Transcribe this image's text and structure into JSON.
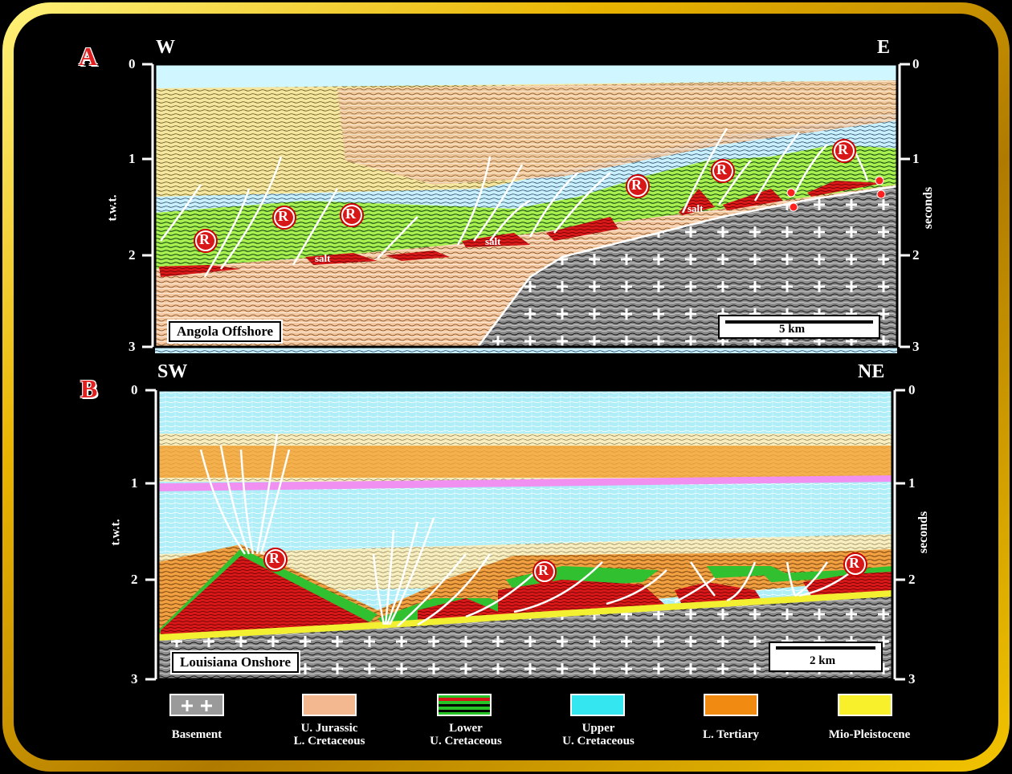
{
  "panel_a": {
    "letter": "A",
    "left_dir": "W",
    "right_dir": "E",
    "left_axis_label": "t.w.t.",
    "right_axis_label": "seconds",
    "ticks": [
      "0",
      "1",
      "2",
      "3"
    ],
    "location": "Angola Offshore",
    "scale": "5 km",
    "salt_label": "salt",
    "reservoir_symbol": "R"
  },
  "panel_b": {
    "letter": "B",
    "left_dir": "SW",
    "right_dir": "NE",
    "left_axis_label": "t.w.t.",
    "right_axis_label": "seconds",
    "ticks": [
      "0",
      "1",
      "2",
      "3"
    ],
    "location": "Louisiana Onshore",
    "scale": "2 km",
    "reservoir_symbol": "R"
  },
  "legend": [
    {
      "label": "Basement",
      "color": "#a0a0a0",
      "icon": "basement-cross-pattern"
    },
    {
      "label": "U. Jurassic\nL. Cretaceous",
      "color": "#f4b890"
    },
    {
      "label": "Lower\nU. Cretaceous",
      "color": "#27c427"
    },
    {
      "label": "Upper\nU. Cretaceous",
      "color": "#33e6f0"
    },
    {
      "label": "L. Tertiary",
      "color": "#f08a10"
    },
    {
      "label": "Mio-Pleistocene",
      "color": "#f7f02a"
    }
  ],
  "colors": {
    "frame_outer": "#c89a00",
    "frame_inner": "#f5d000",
    "reservoir_red": "#d81818",
    "salt_red": "#cc1010",
    "basement_grey": "#8a8a8a",
    "seawater": "#c8f4ff",
    "pink_marker": "#f080f0"
  }
}
